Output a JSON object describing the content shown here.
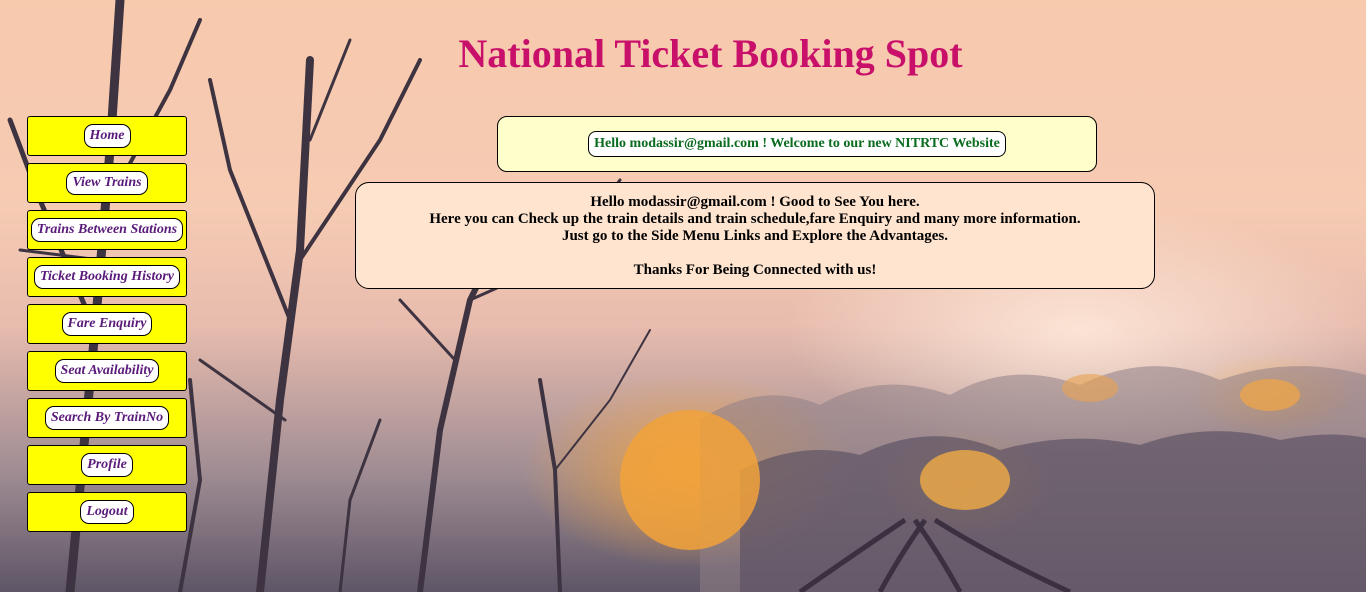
{
  "page": {
    "title": "National Ticket Booking Spot"
  },
  "sidebar": {
    "items": [
      {
        "label": "Home"
      },
      {
        "label": "View Trains"
      },
      {
        "label": "Trains Between Stations"
      },
      {
        "label": "Ticket Booking History"
      },
      {
        "label": "Fare Enquiry"
      },
      {
        "label": "Seat Availability"
      },
      {
        "label": "Search By TrainNo"
      },
      {
        "label": "Profile"
      },
      {
        "label": "Logout"
      }
    ]
  },
  "welcome": {
    "text": "Hello modassir@gmail.com ! Welcome to our new NITRTC Website"
  },
  "info": {
    "line1": "Hello modassir@gmail.com ! Good to See You here.",
    "line2": "Here you can Check up the train details and train schedule,fare Enquiry and many more information.",
    "line3": "Just go to the Side Menu Links and Explore the Advantages.",
    "line4": "Thanks For Being Connected with us!"
  },
  "colors": {
    "title": "#c8106a",
    "menu_background": "#ffff00",
    "menu_text": "#5a1a7a",
    "welcome_background": "#ffffcc",
    "welcome_text": "#0b6b1f",
    "info_background": "#ffe4cf"
  }
}
